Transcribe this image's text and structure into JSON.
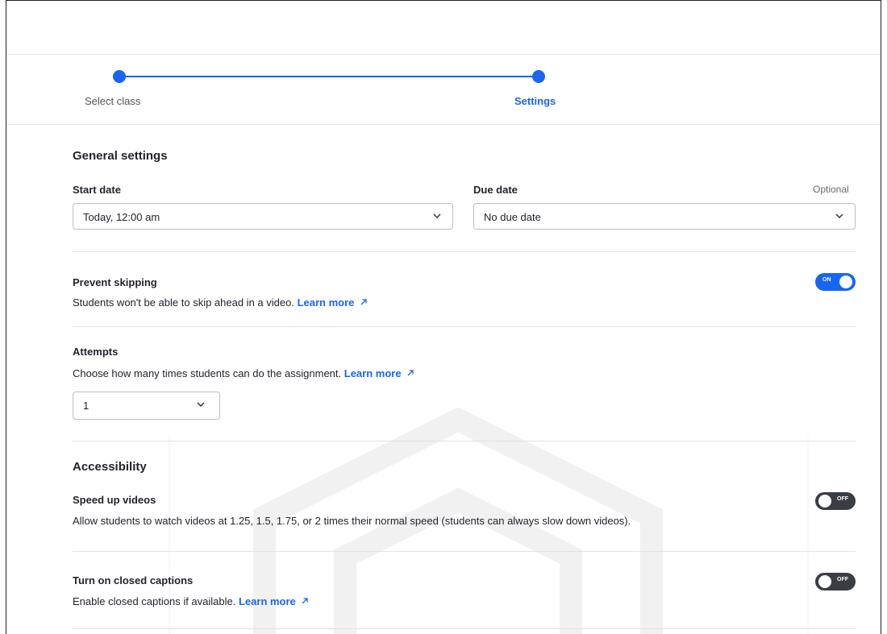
{
  "stepper": {
    "steps": [
      {
        "label": "Select class",
        "state": "completed"
      },
      {
        "label": "Settings",
        "state": "active"
      }
    ]
  },
  "general": {
    "title": "General settings",
    "start_date": {
      "label": "Start date",
      "value": "Today, 12:00 am"
    },
    "due_date": {
      "label": "Due date",
      "optional_label": "Optional",
      "value": "No due date"
    }
  },
  "prevent_skipping": {
    "title": "Prevent skipping",
    "description": "Students won't be able to skip ahead in a video.",
    "link": "Learn more",
    "toggle": {
      "state": "ON"
    }
  },
  "attempts": {
    "title": "Attempts",
    "description": "Choose how many times students can do the assignment.",
    "link": "Learn more",
    "value": "1"
  },
  "accessibility": {
    "title": "Accessibility",
    "speed_up": {
      "title": "Speed up videos",
      "description": "Allow students to watch videos at 1.25, 1.5, 1.75, or 2 times their normal speed (students can always slow down videos).",
      "toggle": {
        "state": "OFF"
      }
    },
    "captions": {
      "title": "Turn on closed captions",
      "description": "Enable closed captions if available.",
      "link": "Learn more",
      "toggle": {
        "state": "OFF"
      }
    }
  },
  "colors": {
    "accent": "#1865f2",
    "toggle_off": "#3b3d45",
    "text": "#21242c"
  }
}
